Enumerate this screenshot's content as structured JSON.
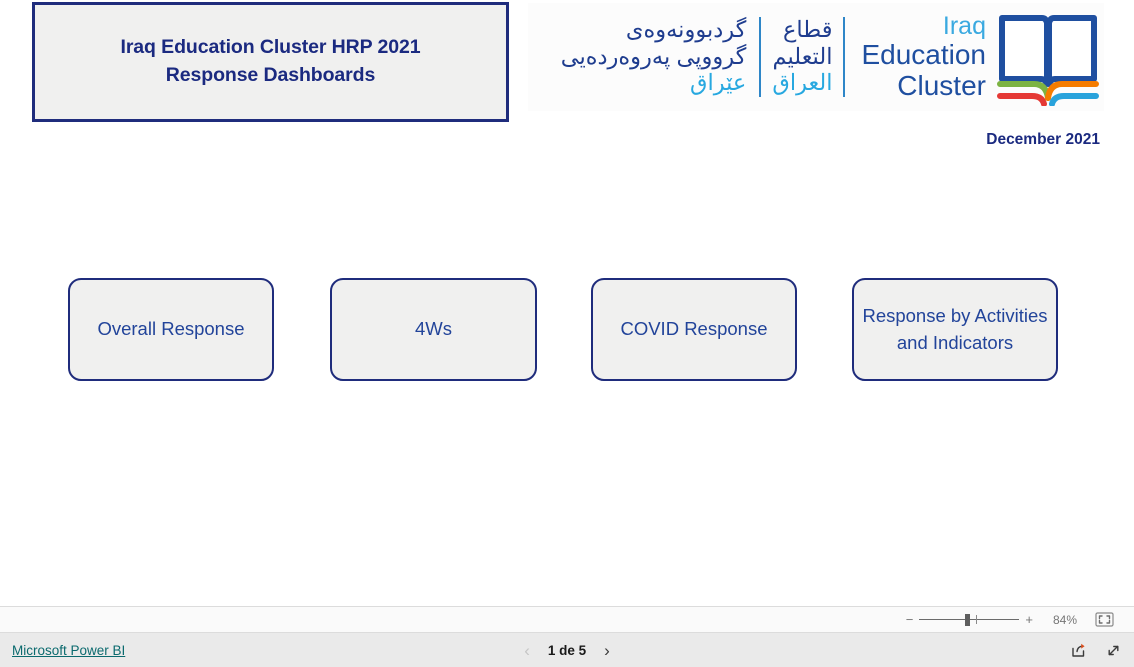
{
  "report": {
    "title_line1": "Iraq Education Cluster HRP 2021",
    "title_line2": "Response Dashboards",
    "date": "December 2021"
  },
  "logo": {
    "kurdish_line1": "گردبوونەوەی",
    "kurdish_line2": "گرووپی پەروەردەیی",
    "kurdish_line3": "عێراق",
    "arabic_line1": "قطاع",
    "arabic_line2": "التعليم",
    "arabic_line3": "العراق",
    "english_line1": "Iraq",
    "english_line2": "Education",
    "english_line3": "Cluster",
    "icon": "open-book-icon",
    "colors": {
      "dark_blue": "#1f4fa0",
      "light_blue": "#3aa9e0",
      "ribbon_green": "#7cb342",
      "ribbon_red": "#e53935",
      "ribbon_orange": "#f57c00",
      "ribbon_blue": "#29a3dc"
    }
  },
  "nav_buttons": [
    {
      "label": "Overall Response"
    },
    {
      "label": "4Ws"
    },
    {
      "label": "COVID Response"
    },
    {
      "label": "Response by Activities and Indicators"
    }
  ],
  "zoombar": {
    "minus": "−",
    "plus": "+",
    "zoom_level": "84%",
    "fit_icon": "fit-to-page-icon"
  },
  "statusbar": {
    "brand_link": "Microsoft Power BI",
    "prev_arrow": "‹",
    "page_label": "1 de 5",
    "next_arrow": "›",
    "share_icon": "share-icon",
    "fullscreen_icon": "fullscreen-icon"
  },
  "theme": {
    "navy": "#1f2c7c",
    "button_fill": "#f0f0ef",
    "link_teal": "#0b6a6e",
    "canvas": "#ffffff"
  }
}
